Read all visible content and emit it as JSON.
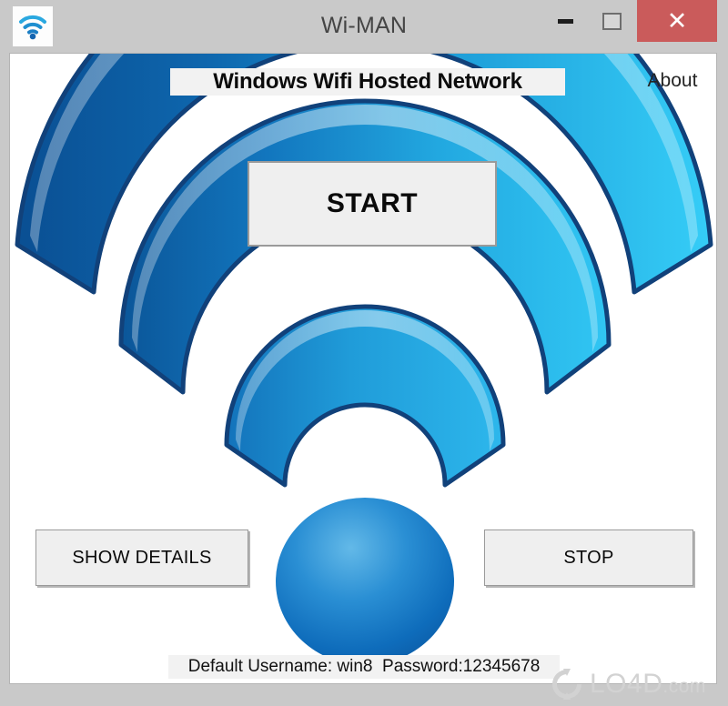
{
  "window": {
    "title": "Wi-MAN",
    "app_icon": "wifi-icon",
    "controls": {
      "minimize": "−",
      "maximize": "□",
      "close": "✕",
      "close_color": "#ca5b5b"
    }
  },
  "header": {
    "title": "Windows Wifi Hosted Network",
    "about_label": "About"
  },
  "buttons": {
    "start": "START",
    "show_details": "SHOW DETAILS",
    "stop": "STOP"
  },
  "status": {
    "text": "Default Username: win8  Password:12345678",
    "username": "win8",
    "password": "12345678"
  },
  "graphic": {
    "name": "wifi-signal-graphic",
    "arc_count": 3,
    "colors": {
      "arc_dark_blue": "#0B5FA5",
      "arc_light_blue": "#2EC3F2",
      "arc_outline": "#123F73",
      "dot_highlight": "#4FA9E0",
      "dot_base": "#0A64B4"
    }
  },
  "watermark": {
    "text": "LO4D",
    "suffix": ".com",
    "icon": "refresh-arrows-icon"
  }
}
